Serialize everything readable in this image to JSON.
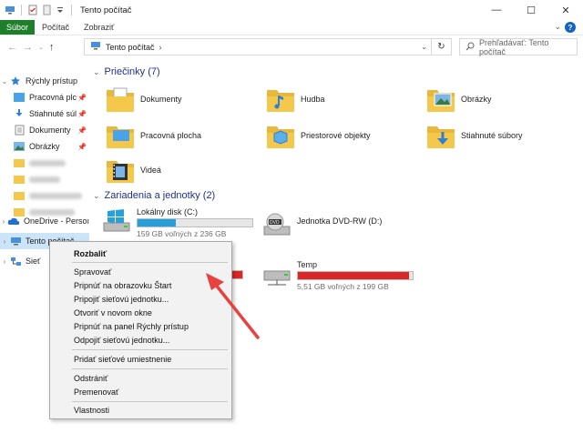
{
  "window": {
    "title": "Tento počítač",
    "controls": [
      "—",
      "☐",
      "✕"
    ]
  },
  "ribbon": {
    "tabs": [
      {
        "label": "Súbor",
        "active": true
      },
      {
        "label": "Počítač",
        "active": false
      },
      {
        "label": "Zobraziť",
        "active": false
      }
    ]
  },
  "address": {
    "path": "Tento počítač",
    "search_placeholder": "Prehľadávať: Tento počítač"
  },
  "sidebar": {
    "quick_access": "Rýchly prístup",
    "pinned": [
      {
        "label": "Pracovná plc",
        "icon": "desktop-icon"
      },
      {
        "label": "Stiahnuté súl",
        "icon": "download-icon"
      },
      {
        "label": "Dokumenty",
        "icon": "documents-icon"
      },
      {
        "label": "Obrázky",
        "icon": "pictures-icon"
      }
    ],
    "onedrive": "OneDrive - Persoı",
    "this_pc": "Tento počítač",
    "network": "Sieť"
  },
  "groups": {
    "folders_title": "Priečinky (7)",
    "drives_title": "Zariadenia a jednotky (2)"
  },
  "folders": [
    {
      "label": "Dokumenty",
      "icon": "documents-folder-icon"
    },
    {
      "label": "Hudba",
      "icon": "music-folder-icon"
    },
    {
      "label": "Obrázky",
      "icon": "pictures-folder-icon"
    },
    {
      "label": "Pracovná plocha",
      "icon": "desktop-folder-icon"
    },
    {
      "label": "Priestorové objekty",
      "icon": "3d-objects-folder-icon"
    },
    {
      "label": "Stiahnuté súbory",
      "icon": "downloads-folder-icon"
    },
    {
      "label": "Videá",
      "icon": "videos-folder-icon"
    }
  ],
  "drives": [
    {
      "label": "Lokálny disk (C:)",
      "free": "159 GB voľných z 236 GB",
      "used_fraction": 0.33,
      "color": "#26a0da"
    },
    {
      "label": "Jednotka DVD-RW (D:)",
      "free": "",
      "used_fraction": 0,
      "color": ""
    },
    {
      "label": "Temp",
      "free": "5,51 GB voľných z 199 GB",
      "used_fraction": 0.97,
      "color": "#da2626"
    }
  ],
  "context_menu": {
    "items": [
      {
        "label": "Rozbaliť",
        "bold": true
      },
      {
        "label": "Spravovať"
      },
      {
        "label": "Pripnúť na obrazovku Štart"
      },
      {
        "label": "Pripojiť sieťovú jednotku..."
      },
      {
        "label": "Otvoriť v novom okne"
      },
      {
        "label": "Pripnúť na panel Rýchly prístup"
      },
      {
        "label": "Odpojiť sieťovú jednotku..."
      },
      {
        "label": "Pridať sieťové umiestnenie"
      },
      {
        "label": "Odstrániť"
      },
      {
        "label": "Premenovať"
      },
      {
        "label": "Vlastnosti"
      }
    ]
  },
  "colors": {
    "accent_green": "#1e7e2c",
    "folder_yellow": "#f4c84a",
    "selection_blue": "#cce4f7",
    "annotation_red": "#e8413f"
  }
}
